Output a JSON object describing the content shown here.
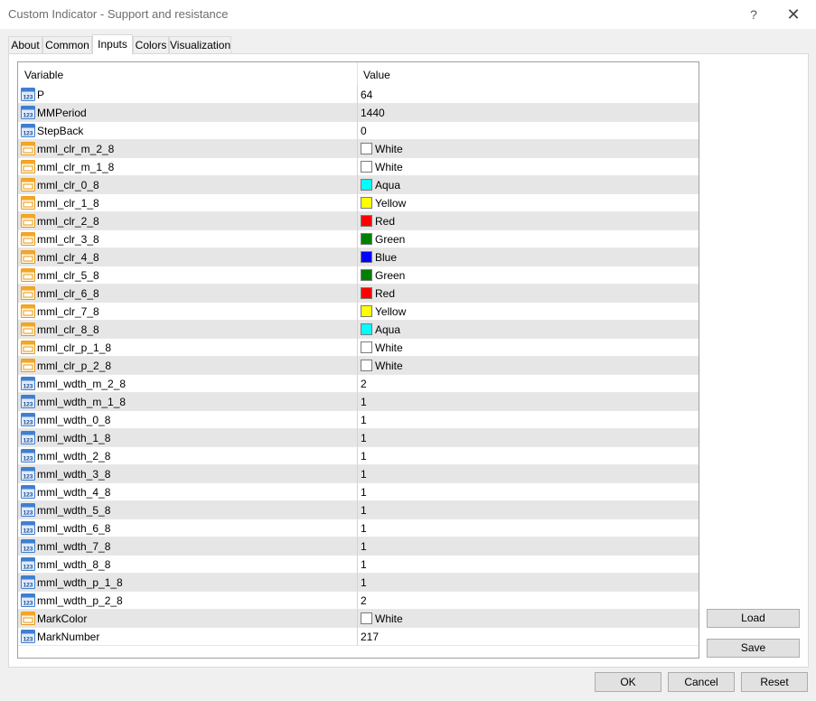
{
  "window": {
    "title": "Custom Indicator - Support and resistance",
    "help_label": "?",
    "close_label": "✕"
  },
  "tabs": [
    {
      "label": "About"
    },
    {
      "label": "Common"
    },
    {
      "label": "Inputs",
      "active": true
    },
    {
      "label": "Colors"
    },
    {
      "label": "Visualization"
    }
  ],
  "grid": {
    "col_variable": "Variable",
    "col_value": "Value",
    "rows": [
      {
        "name": "P",
        "value": "64",
        "type": "number-icon"
      },
      {
        "name": "MMPeriod",
        "value": "1440",
        "type": "number-icon"
      },
      {
        "name": "StepBack",
        "value": "0",
        "type": "number-icon"
      },
      {
        "name": "mml_clr_m_2_8",
        "value": "White",
        "type": "color-icon",
        "swatch": "#ffffff"
      },
      {
        "name": "mml_clr_m_1_8",
        "value": "White",
        "type": "color-icon",
        "swatch": "#ffffff"
      },
      {
        "name": "mml_clr_0_8",
        "value": "Aqua",
        "type": "color-icon",
        "swatch": "#00ffff"
      },
      {
        "name": "mml_clr_1_8",
        "value": "Yellow",
        "type": "color-icon",
        "swatch": "#ffff00"
      },
      {
        "name": "mml_clr_2_8",
        "value": "Red",
        "type": "color-icon",
        "swatch": "#ff0000"
      },
      {
        "name": "mml_clr_3_8",
        "value": "Green",
        "type": "color-icon",
        "swatch": "#008000"
      },
      {
        "name": "mml_clr_4_8",
        "value": "Blue",
        "type": "color-icon",
        "swatch": "#0000ff"
      },
      {
        "name": "mml_clr_5_8",
        "value": "Green",
        "type": "color-icon",
        "swatch": "#008000"
      },
      {
        "name": "mml_clr_6_8",
        "value": "Red",
        "type": "color-icon",
        "swatch": "#ff0000"
      },
      {
        "name": "mml_clr_7_8",
        "value": "Yellow",
        "type": "color-icon",
        "swatch": "#ffff00"
      },
      {
        "name": "mml_clr_8_8",
        "value": "Aqua",
        "type": "color-icon",
        "swatch": "#00ffff"
      },
      {
        "name": "mml_clr_p_1_8",
        "value": "White",
        "type": "color-icon",
        "swatch": "#ffffff"
      },
      {
        "name": "mml_clr_p_2_8",
        "value": "White",
        "type": "color-icon",
        "swatch": "#ffffff"
      },
      {
        "name": "mml_wdth_m_2_8",
        "value": "2",
        "type": "number-icon"
      },
      {
        "name": "mml_wdth_m_1_8",
        "value": "1",
        "type": "number-icon"
      },
      {
        "name": "mml_wdth_0_8",
        "value": "1",
        "type": "number-icon"
      },
      {
        "name": "mml_wdth_1_8",
        "value": "1",
        "type": "number-icon"
      },
      {
        "name": "mml_wdth_2_8",
        "value": "1",
        "type": "number-icon"
      },
      {
        "name": "mml_wdth_3_8",
        "value": "1",
        "type": "number-icon"
      },
      {
        "name": "mml_wdth_4_8",
        "value": "1",
        "type": "number-icon"
      },
      {
        "name": "mml_wdth_5_8",
        "value": "1",
        "type": "number-icon"
      },
      {
        "name": "mml_wdth_6_8",
        "value": "1",
        "type": "number-icon"
      },
      {
        "name": "mml_wdth_7_8",
        "value": "1",
        "type": "number-icon"
      },
      {
        "name": "mml_wdth_8_8",
        "value": "1",
        "type": "number-icon"
      },
      {
        "name": "mml_wdth_p_1_8",
        "value": "1",
        "type": "number-icon"
      },
      {
        "name": "mml_wdth_p_2_8",
        "value": "2",
        "type": "number-icon"
      },
      {
        "name": "MarkColor",
        "value": "White",
        "type": "color-icon",
        "swatch": "#ffffff"
      },
      {
        "name": "MarkNumber",
        "value": "217",
        "type": "number-icon"
      }
    ]
  },
  "side_buttons": {
    "load": "Load",
    "save": "Save"
  },
  "bottom_buttons": {
    "ok": "OK",
    "cancel": "Cancel",
    "reset": "Reset"
  },
  "colors": {
    "row_alt": "#e6e6e6",
    "number_icon": "#3f7fd0",
    "color_icon": "#f5a623"
  }
}
